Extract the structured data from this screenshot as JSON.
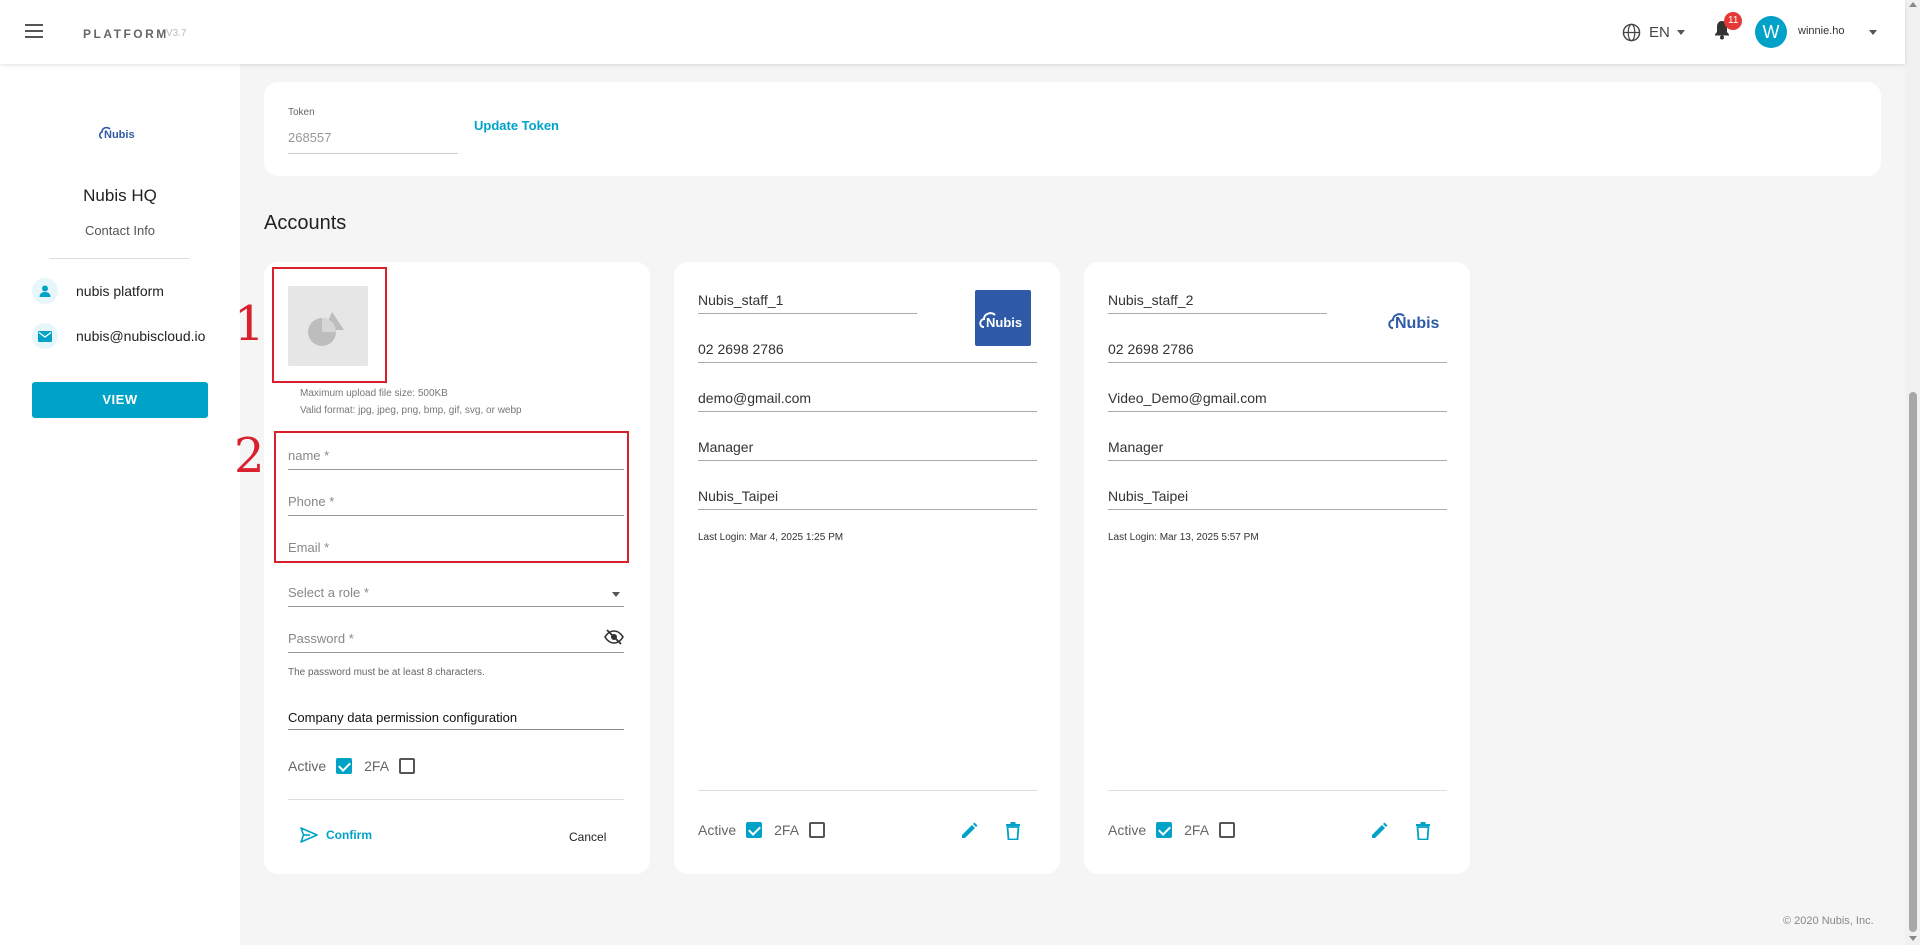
{
  "header": {
    "brand": "PLATFORM",
    "version": "V3.7",
    "language": "EN",
    "notification_count": "11",
    "avatar_initial": "W",
    "username": "winnie.ho"
  },
  "sidebar": {
    "company_name": "Nubis HQ",
    "contact_info_label": "Contact Info",
    "contacts": [
      {
        "icon": "person-icon",
        "text": "nubis platform"
      },
      {
        "icon": "mail-icon",
        "text": "nubis@nubiscloud.io"
      }
    ],
    "view_button": "VIEW"
  },
  "token": {
    "label": "Token",
    "value": "268557",
    "update_label": "Update Token"
  },
  "accounts_title": "Accounts",
  "new_account_form": {
    "upload_hint_size": "Maximum upload file size: 500KB",
    "upload_hint_format": "Valid format: jpg, jpeg, png, bmp, gif, svg, or webp",
    "name_placeholder": "name *",
    "phone_placeholder": "Phone *",
    "email_placeholder": "Email *",
    "role_placeholder": "Select a role *",
    "password_placeholder": "Password *",
    "password_hint": "The password must be at least 8 characters.",
    "permission_label": "Company data permission configuration",
    "active_label": "Active",
    "active_checked": true,
    "twofa_label": "2FA",
    "twofa_checked": false,
    "confirm_label": "Confirm",
    "cancel_label": "Cancel"
  },
  "accounts": [
    {
      "name": "Nubis_staff_1",
      "phone": "02 2698 2786",
      "email": "demo@gmail.com",
      "role": "Manager",
      "location": "Nubis_Taipei",
      "last_login": "Last Login: Mar 4, 2025 1:25 PM",
      "active_label": "Active",
      "active_checked": true,
      "twofa_label": "2FA",
      "twofa_checked": false,
      "logo_text": "Nubis"
    },
    {
      "name": "Nubis_staff_2",
      "phone": "02 2698 2786",
      "email": "Video_Demo@gmail.com",
      "role": "Manager",
      "location": "Nubis_Taipei",
      "last_login": "Last Login: Mar 13, 2025 5:57 PM",
      "active_label": "Active",
      "active_checked": true,
      "twofa_label": "2FA",
      "twofa_checked": false,
      "logo_text": "Nubis"
    }
  ],
  "annotations": [
    "1",
    "2"
  ],
  "footer": "© 2020 Nubis, Inc.",
  "colors": {
    "accent": "#00a2c7",
    "annotation": "#d9202d",
    "badge": "#e53935",
    "logo_blue": "#2e5aa7"
  }
}
